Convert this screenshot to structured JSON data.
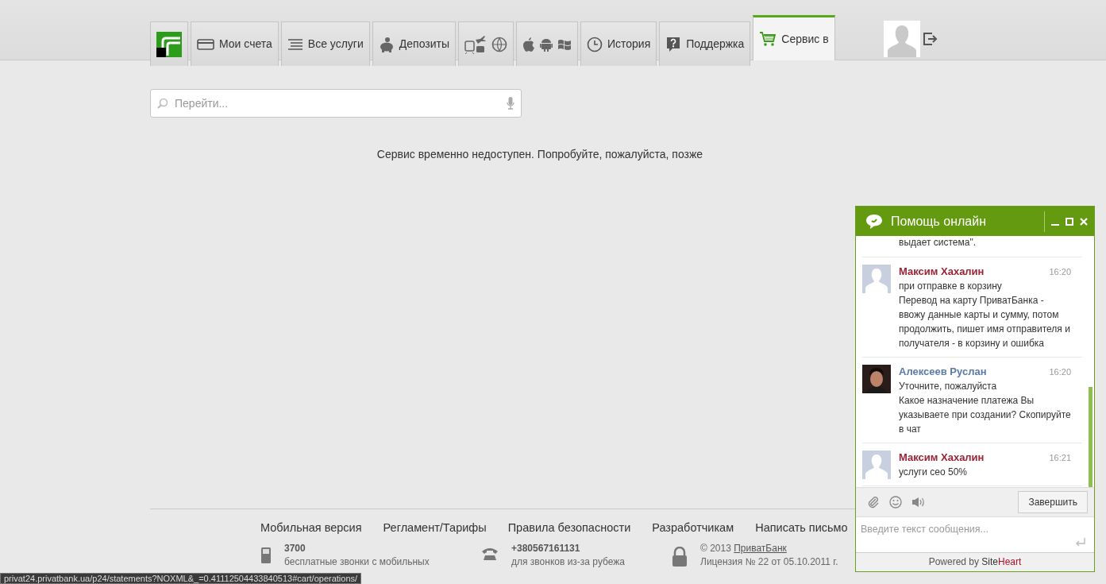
{
  "tabs": [
    {
      "kind": "logo",
      "selected": false
    },
    {
      "kind": "label",
      "label": "Мои счета",
      "selected": false
    },
    {
      "kind": "label",
      "label": "Все услуги",
      "selected": false
    },
    {
      "kind": "label",
      "label": "Депозиты",
      "selected": false
    },
    {
      "kind": "icons",
      "selected": false
    },
    {
      "kind": "icons",
      "selected": false
    },
    {
      "kind": "label",
      "label": "История",
      "selected": false
    },
    {
      "kind": "label",
      "label": "Поддержка",
      "selected": false
    },
    {
      "kind": "label",
      "label": "Сервис в",
      "selected": true
    }
  ],
  "search": {
    "placeholder": "Перейти..."
  },
  "message": "Сервис временно недоступен. Попробуйте, пожалуйста, позже",
  "footer": {
    "links": [
      "Мобильная версия",
      "Регламент/Тарифы",
      "Правила безопасности",
      "Разработчикам",
      "Написать письмо"
    ],
    "info": [
      {
        "title": "3700",
        "text": "бесплатные звонки с мобильных"
      },
      {
        "title": "+380567161131",
        "text": "для звонков из-за рубежа"
      },
      {
        "copyright": "© 2013",
        "link": "ПриватБанк",
        "text": "Лицензия № 22 от 05.10.2011 г."
      }
    ]
  },
  "status_bar": "privat24.privatbank.ua/p24/statements?NOXML&_=0.41112504433840513#cart/operations/",
  "chat": {
    "title": "Помощь онлайн",
    "partial_text": "выдает система\".",
    "messages": [
      {
        "kind": "client",
        "author": "Максим Хахалин",
        "time": "16:20",
        "lines": [
          "при отправке в корзину",
          "Перевод на карту ПриватБанка - ввожу данные карты и сумму, потом продолжить, пишет имя отправителя и получателя - в корзину и ошибка"
        ]
      },
      {
        "kind": "operator",
        "author": "Алексеев Руслан",
        "time": "16:20",
        "lines": [
          "Уточните, пожалуйста",
          "Какое назначение платежа Вы указываете при создании? Скопируйте в чат"
        ]
      },
      {
        "kind": "client",
        "author": "Максим Хахалин",
        "time": "16:21",
        "lines": [
          "услуги сео 50%"
        ]
      }
    ],
    "finish_button": "Завершить",
    "input": {
      "placeholder": "Введите текст сообщения..."
    },
    "powered": "Powered by",
    "brand_a": "Site",
    "brand_b": "Heart"
  }
}
